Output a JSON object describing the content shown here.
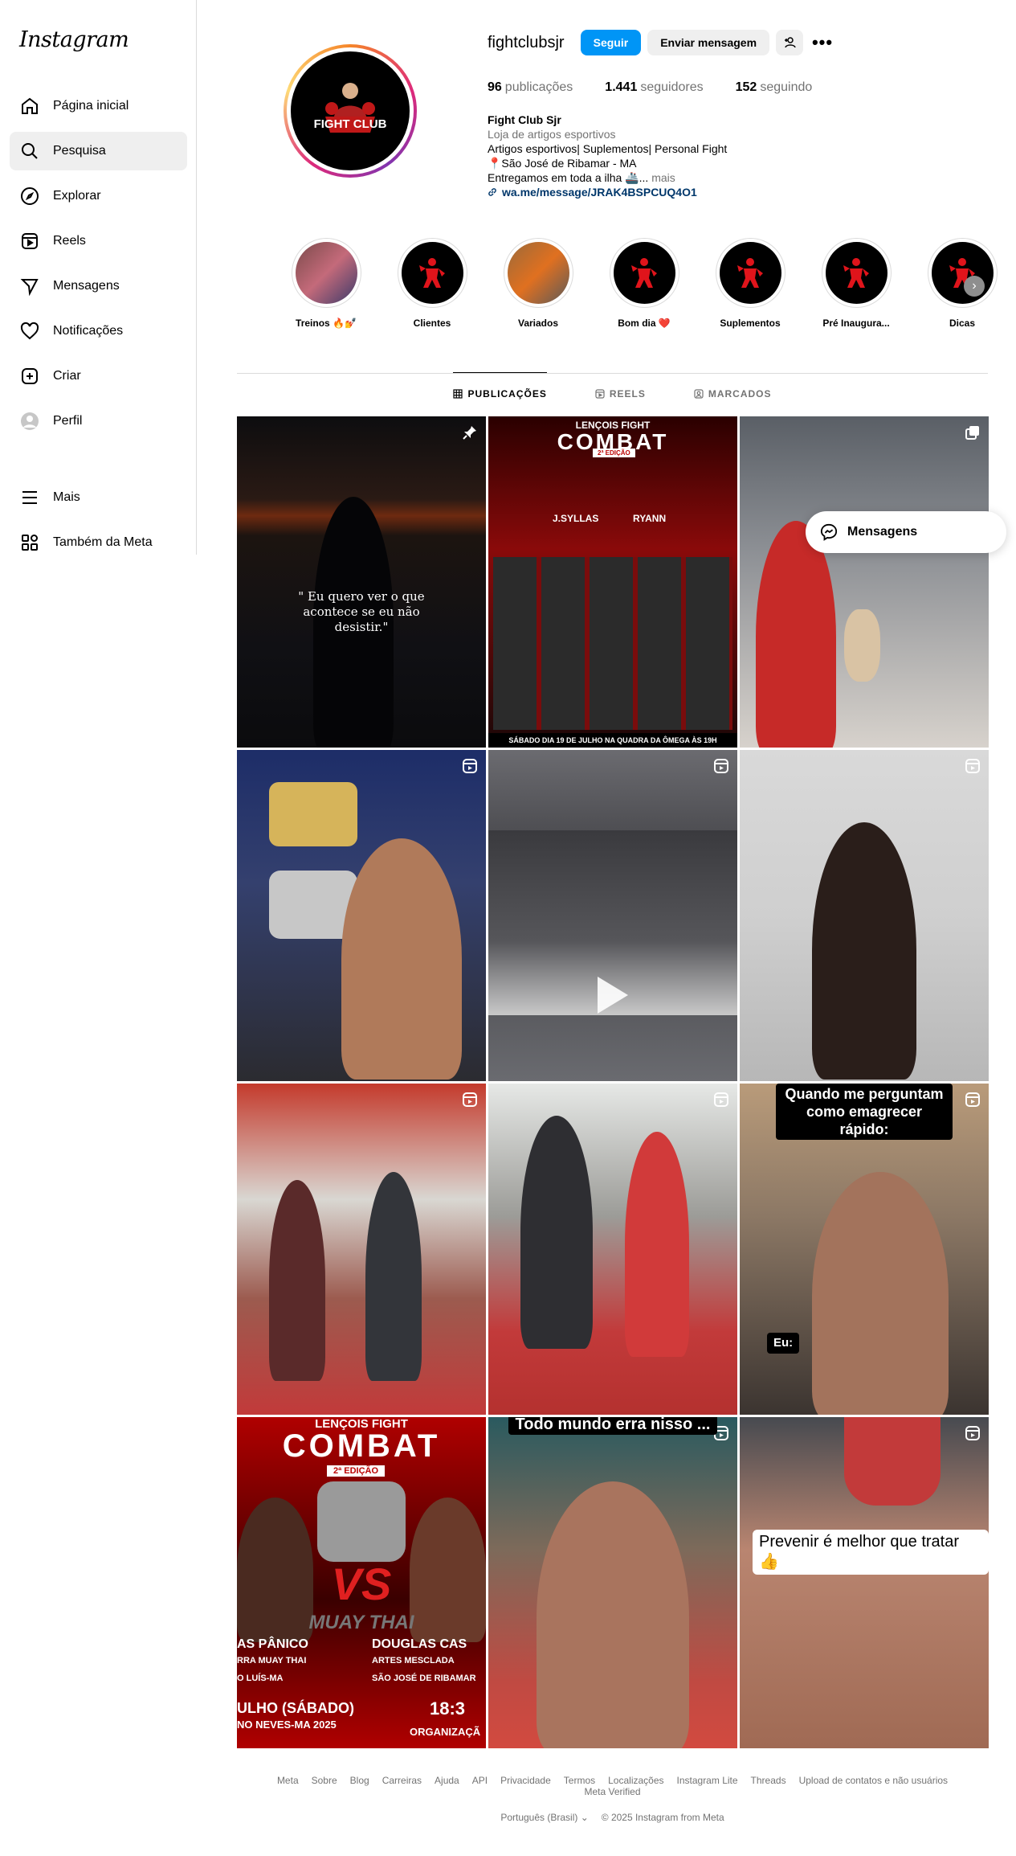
{
  "app": {
    "logo": "Instagram"
  },
  "sidebar": {
    "items": [
      {
        "label": "Página inicial",
        "icon": "home-icon"
      },
      {
        "label": "Pesquisa",
        "icon": "search-icon"
      },
      {
        "label": "Explorar",
        "icon": "explore-icon"
      },
      {
        "label": "Reels",
        "icon": "reels-icon"
      },
      {
        "label": "Mensagens",
        "icon": "messages-icon"
      },
      {
        "label": "Notificações",
        "icon": "heart-icon"
      },
      {
        "label": "Criar",
        "icon": "create-icon"
      },
      {
        "label": "Perfil",
        "icon": "profile-icon"
      }
    ],
    "bottom_items": [
      {
        "label": "Mais",
        "icon": "menu-icon"
      },
      {
        "label": "Também da Meta",
        "icon": "meta-icon"
      }
    ]
  },
  "profile": {
    "username": "fightclubsjr",
    "follow_label": "Seguir",
    "message_label": "Enviar mensagem",
    "stats": {
      "posts_num": "96",
      "posts_label": "publicações",
      "followers_num": "1.441",
      "followers_label": "seguidores",
      "following_num": "152",
      "following_label": "seguindo"
    },
    "name": "Fight Club Sjr",
    "category": "Loja de artigos esportivos",
    "bio_line1": "Artigos esportivos| Suplementos| Personal Fight",
    "bio_line2": "📍São José de Ribamar - MA",
    "bio_line3": "Entregamos em toda a ilha 🚢...",
    "more": "mais",
    "link": "wa.me/message/JRAK4BSPCUQ4O1",
    "avatar_text": "FIGHT CLUB"
  },
  "highlights": [
    {
      "label": "Treinos 🔥💅"
    },
    {
      "label": "Clientes"
    },
    {
      "label": "Variados"
    },
    {
      "label": "Bom dia ❤️"
    },
    {
      "label": "Suplementos"
    },
    {
      "label": "Pré Inaugura..."
    },
    {
      "label": "Dicas"
    }
  ],
  "tabs": [
    {
      "label": "PUBLICAÇÕES",
      "active": true
    },
    {
      "label": "REELS",
      "active": false
    },
    {
      "label": "MARCADOS",
      "active": false
    }
  ],
  "posts": {
    "p1_quote": "\" Eu quero ver o que acontece se eu não desistir.\"",
    "p2_title": "LENÇOIS FIGHT",
    "p2_combat": "COMBAT",
    "p2_edition": "2ª EDIÇÃO",
    "p2_left": "J.SYLLAS",
    "p2_right": "RYANN",
    "p2_footer": "SÁBADO DIA 19 DE JULHO NA QUADRA DA ÔMEGA ÀS 19H",
    "p9_caption": "Quando me perguntam como emagrecer rápido:",
    "p9_eu": "Eu:",
    "p10_title": "LENÇOIS FIGHT",
    "p10_combat": "COMBAT",
    "p10_edition": "2ª EDIÇÃO",
    "p10_vs": "VS",
    "p10_style": "MUAY THAI",
    "p10_left": "AS PÂNICO",
    "p10_right": "DOUGLAS CAS",
    "p10_left_sub": "RRA MUAY THAI",
    "p10_right_sub": "ARTES MESCLADA",
    "p10_left_city": "O LUÍS-MA",
    "p10_right_city": "SÃO JOSÉ DE RIBAMAR",
    "p10_date": "ULHO (SÁBADO)",
    "p10_place": "NO NEVES-MA 2025",
    "p10_time": "18:3",
    "p10_org": "ORGANIZAÇÃ",
    "p11_caption": "Todo mundo erra nisso ...",
    "p12_caption": "Prevenir é melhor que tratar 👍"
  },
  "floating": {
    "messages_label": "Mensagens"
  },
  "footer": {
    "links": [
      "Meta",
      "Sobre",
      "Blog",
      "Carreiras",
      "Ajuda",
      "API",
      "Privacidade",
      "Termos",
      "Localizações",
      "Instagram Lite",
      "Threads",
      "Upload de contatos e não usuários",
      "Meta Verified"
    ],
    "language": "Português (Brasil) ⌄",
    "copyright": "© 2025 Instagram from Meta"
  },
  "colors": {
    "accent": "#0095f6",
    "link": "#00376b"
  }
}
